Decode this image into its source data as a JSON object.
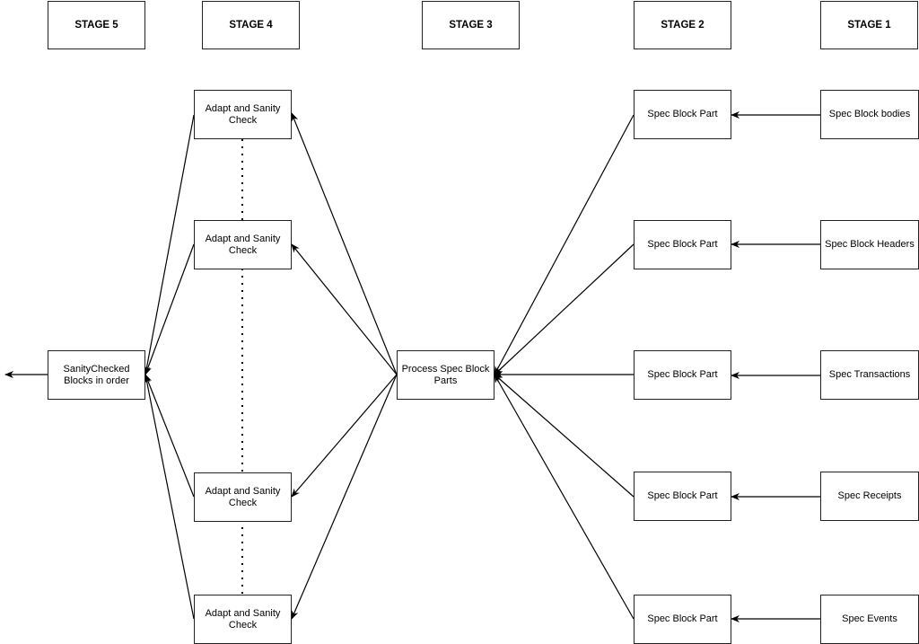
{
  "stages": [
    "STAGE 5",
    "STAGE 4",
    "STAGE 3",
    "STAGE 2",
    "STAGE 1"
  ],
  "stage5": {
    "label": "SanityChecked Blocks in order"
  },
  "stage4": {
    "items": [
      "Adapt and Sanity Check",
      "Adapt and Sanity Check",
      "Adapt and Sanity Check",
      "Adapt and Sanity Check"
    ]
  },
  "stage3": {
    "label": "Process Spec Block Parts"
  },
  "stage2": {
    "items": [
      "Spec Block Part",
      "Spec Block Part",
      "Spec Block Part",
      "Spec Block Part",
      "Spec Block Part"
    ]
  },
  "stage1": {
    "items": [
      "Spec Block bodies",
      "Spec Block Headers",
      "Spec Transactions",
      "Spec Receipts",
      "Spec Events"
    ]
  },
  "colors": {
    "stroke": "#000000",
    "fill": "#ffffff"
  }
}
